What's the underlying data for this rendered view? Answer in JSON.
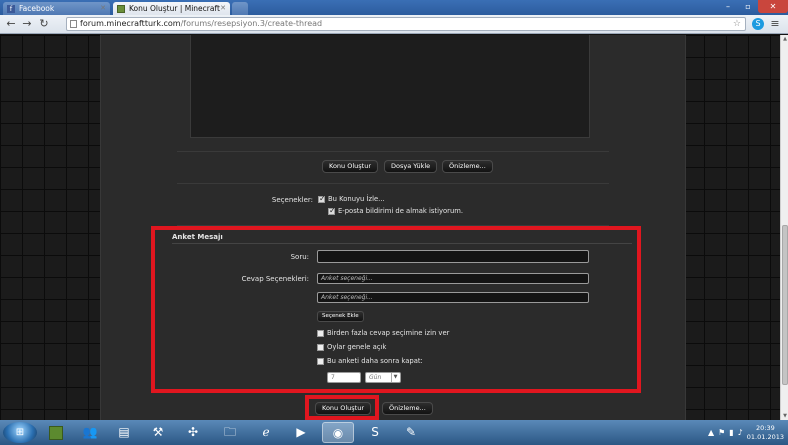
{
  "browser": {
    "tabs": [
      {
        "label": "Facebook",
        "icon": "facebook-icon",
        "active": false
      },
      {
        "label": "Konu Oluştur | Minecraft",
        "icon": "minecraft-icon",
        "active": true
      }
    ],
    "url_domain": "forum.minecraftturk.com",
    "url_path": "/forums/resepsiyon.3/create-thread"
  },
  "form": {
    "buttons": {
      "create_thread": "Konu Oluştur",
      "upload_file": "Dosya Yükle",
      "preview": "Önizleme..."
    },
    "options_label": "Seçenekler:",
    "watch_thread": "Bu Konuyu İzle...",
    "email_notify": "E-posta bildirimi de almak istiyorum.",
    "poll": {
      "title": "Anket Mesajı",
      "question_label": "Soru:",
      "answers_label": "Cevap Seçenekleri:",
      "answer_placeholder": "Anket seçeneği...",
      "add_option_button": "Seçenek Ekle",
      "multiple_choice": "Birden fazla cevap seçimine izin ver",
      "public_votes": "Oylar genele açık",
      "close_after": "Bu anketi daha sonra kapat:",
      "close_after_value": "7",
      "close_after_unit": "Gün"
    },
    "bottom": {
      "create_thread": "Konu Oluştur",
      "preview": "Önizleme..."
    }
  },
  "taskbar": {
    "time": "20:39",
    "date": "01.01.2013"
  },
  "colors": {
    "highlight": "#e0161f",
    "page_bg": "#2b2b2b"
  }
}
